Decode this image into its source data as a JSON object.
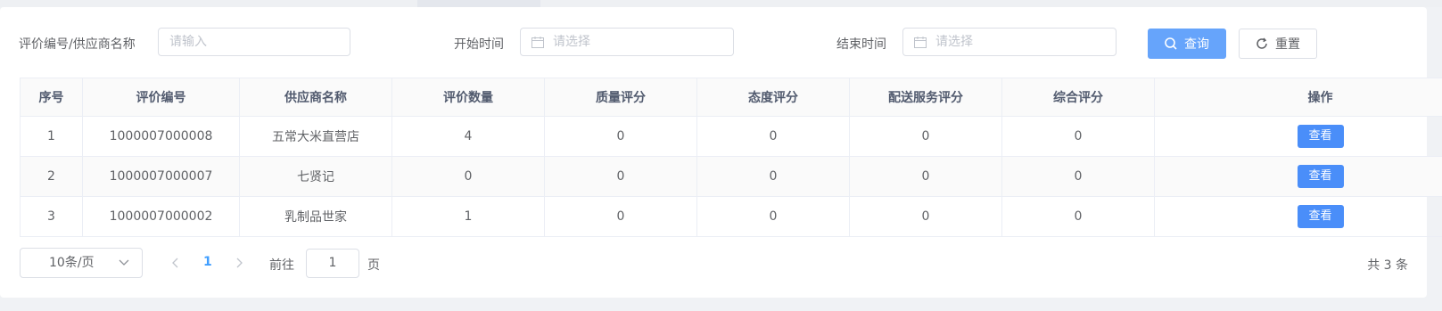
{
  "filters": {
    "code_label": "评价编号/供应商名称",
    "code_placeholder": "请输入",
    "start_label": "开始时间",
    "start_placeholder": "请选择",
    "end_label": "结束时间",
    "end_placeholder": "请选择"
  },
  "buttons": {
    "search": "查询",
    "reset": "重置"
  },
  "table": {
    "headers": [
      "序号",
      "评价编号",
      "供应商名称",
      "评价数量",
      "质量评分",
      "态度评分",
      "配送服务评分",
      "综合评分",
      "操作"
    ],
    "rows": [
      {
        "index": "1",
        "code": "1000007000008",
        "supplier": "五常大米直营店",
        "count": "4",
        "quality": "0",
        "attitude": "0",
        "delivery": "0",
        "overall": "0",
        "action": "查看"
      },
      {
        "index": "2",
        "code": "1000007000007",
        "supplier": "七贤记",
        "count": "0",
        "quality": "0",
        "attitude": "0",
        "delivery": "0",
        "overall": "0",
        "action": "查看"
      },
      {
        "index": "3",
        "code": "1000007000002",
        "supplier": "乳制品世家",
        "count": "1",
        "quality": "0",
        "attitude": "0",
        "delivery": "0",
        "overall": "0",
        "action": "查看"
      }
    ]
  },
  "pagination": {
    "page_size": "10条/页",
    "current_page": "1",
    "goto_prefix": "前往",
    "goto_value": "1",
    "goto_suffix": "页",
    "total": "共 3 条"
  },
  "colors": {
    "primary": "#66a4fb",
    "view_button": "#4a8ef9",
    "active_page": "#409eff"
  }
}
